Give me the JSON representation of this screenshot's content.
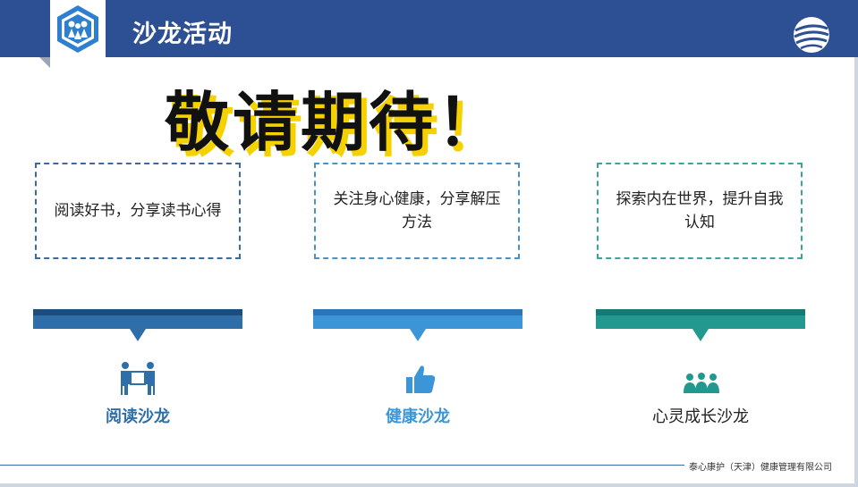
{
  "header": {
    "title": "沙龙活动",
    "logo_icon": "team-logo-icon",
    "brand_icon": "globe-logo-icon",
    "bg_color": "#2d4f94"
  },
  "headline": "敬请期待！",
  "cards": [
    {
      "text": "阅读好书，分享读书心得"
    },
    {
      "text": "关注身心健康，分享解压方法"
    },
    {
      "text": "探索内在世界，提升自我认知"
    }
  ],
  "salons": [
    {
      "label": "阅读沙龙",
      "icon": "people-carrying-box-icon",
      "color": "#2e6faa"
    },
    {
      "label": "健康沙龙",
      "icon": "thumbs-up-icon",
      "color": "#3b95d6"
    },
    {
      "label": "心灵成长沙龙",
      "icon": "group-people-icon",
      "color": "#23988f"
    }
  ],
  "footer": {
    "company": "泰心康护（天津）健康管理有限公司"
  }
}
